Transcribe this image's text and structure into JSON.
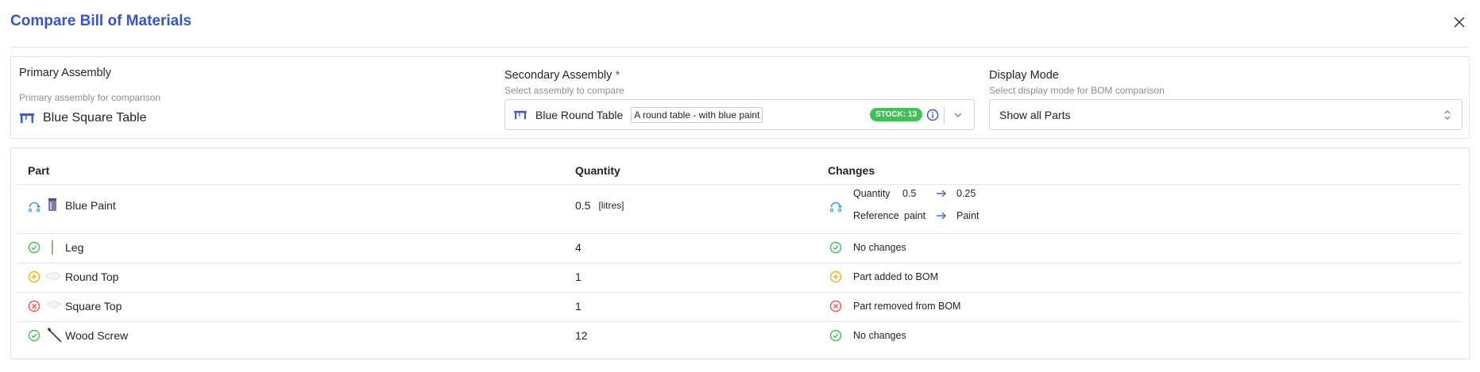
{
  "dialog": {
    "title": "Compare Bill of Materials"
  },
  "primary": {
    "label": "Primary Assembly",
    "help": "Primary assembly for comparison",
    "value": "Blue Square Table",
    "icon": "table-icon"
  },
  "secondary": {
    "label": "Secondary Assembly",
    "required_mark": "*",
    "help": "Select assembly to compare",
    "value": "Blue Round Table",
    "description": "A round table - with blue paint",
    "stock_badge": "STOCK: 13",
    "icon": "table-icon"
  },
  "display_mode": {
    "label": "Display Mode",
    "help": "Select display mode for BOM comparison",
    "value": "Show all Parts"
  },
  "table": {
    "headers": {
      "part": "Part",
      "quantity": "Quantity",
      "changes": "Changes"
    },
    "rows": [
      {
        "status": "modified",
        "name": "Blue Paint",
        "quantity": "0.5",
        "unit": "[litres]",
        "changes": [
          {
            "field": "Quantity",
            "from": "0.5",
            "to": "0.25"
          },
          {
            "field": "Reference",
            "from": "paint",
            "to": "Paint"
          }
        ]
      },
      {
        "status": "unchanged",
        "name": "Leg",
        "quantity": "4",
        "change_text": "No changes"
      },
      {
        "status": "added",
        "name": "Round Top",
        "quantity": "1",
        "change_text": "Part added to BOM"
      },
      {
        "status": "removed",
        "name": "Square Top",
        "quantity": "1",
        "change_text": "Part removed from BOM"
      },
      {
        "status": "unchanged",
        "name": "Wood Screw",
        "quantity": "12",
        "change_text": "No changes"
      }
    ]
  },
  "colors": {
    "accent": "#3454d1",
    "modified": "#339af0",
    "unchanged": "#40c057",
    "added": "#fab005",
    "removed": "#fa5252",
    "stock_badge": "#40c057"
  }
}
